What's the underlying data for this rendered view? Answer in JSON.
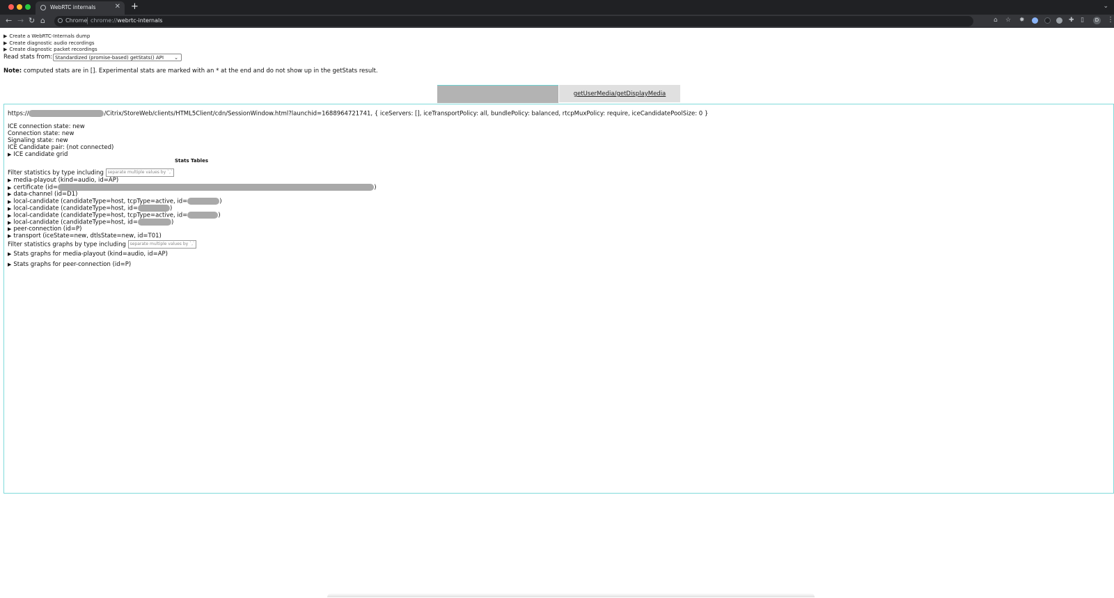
{
  "browser": {
    "tab_title": "WebRTC internals",
    "tab_close": "✕",
    "new_tab": "+",
    "omnibox_chip": "Chrome",
    "url_scheme": "chrome://",
    "url_host": "webrtc-internals",
    "profile_initial": "D"
  },
  "page": {
    "dump_link": "Create a WebRTC-Internals dump",
    "audio_rec_link": "Create diagnostic audio recordings",
    "packet_rec_link": "Create diagnostic packet recordings",
    "read_stats_label": "Read stats from:",
    "read_stats_value": "Standardized (promise-based) getStats() API",
    "note_bold": "Note:",
    "note_text": " computed stats are in []. Experimental stats are marked with an * at the end and do not show up in the getStats result."
  },
  "tabs": {
    "second": "getUserMedia/getDisplayMedia"
  },
  "connection": {
    "url_prefix": "https://",
    "url_suffix": "/Citrix/StoreWeb/clients/HTML5Client/cdn/SessionWindow.html?launchid=1688964721741, { iceServers: [], iceTransportPolicy: all, bundlePolicy: balanced, rtcpMuxPolicy: require, iceCandidatePoolSize: 0 }",
    "ice_state": "ICE connection state: new",
    "conn_state": "Connection state: new",
    "signaling_state": "Signaling state: new",
    "candidate_pair": "ICE Candidate pair: (not connected)",
    "candidate_grid": "ICE candidate grid"
  },
  "stats": {
    "title": "Stats Tables",
    "filter_label": "Filter statistics by type including",
    "filter_placeholder": "separate multiple values by `,`",
    "rows": [
      "media-playout (kind=audio, id=AP)",
      "certificate (id=",
      "data-channel (id=D1)",
      "local-candidate (candidateType=host, tcpType=active, id=",
      "local-candidate (candidateType=host, id=",
      "local-candidate (candidateType=host, tcpType=active, id=",
      "local-candidate (candidateType=host, id=",
      "peer-connection (id=P)",
      "transport (iceState=new, dtlsState=new, id=T01)"
    ],
    "row_close": ")",
    "graph_filter_label": "Filter statistics graphs by type including",
    "graph_filter_placeholder": "separate multiple values by `,`",
    "graph_rows": [
      "Stats graphs for media-playout (kind=audio, id=AP)",
      "Stats graphs for peer-connection (id=P)"
    ]
  },
  "icons": {
    "triangle": "▶",
    "back": "←",
    "forward": "→",
    "reload": "↻",
    "home": "⌂"
  }
}
